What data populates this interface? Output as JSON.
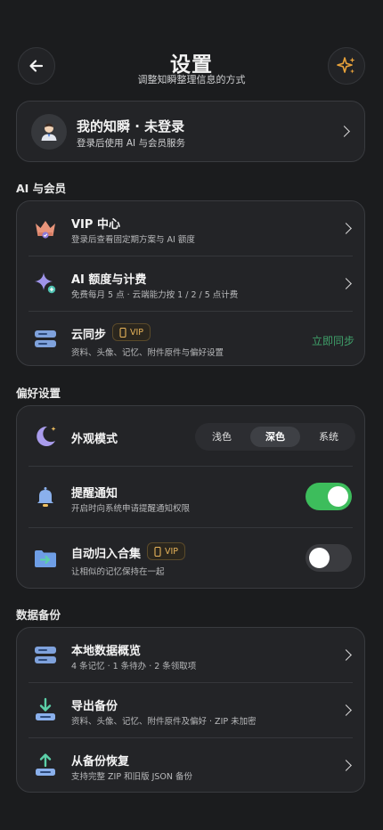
{
  "header": {
    "title": "设置",
    "subtitle": "调整知瞬整理信息的方式"
  },
  "account": {
    "title": "我的知瞬 · 未登录",
    "subtitle": "登录后使用 AI 与会员服务"
  },
  "sections": {
    "ai": "AI 与会员",
    "prefs": "偏好设置",
    "backup": "数据备份"
  },
  "ai_items": {
    "vip_title": "VIP 中心",
    "vip_sub": "登录后查看固定期方案与 AI 额度",
    "quota_title": "AI 额度与计费",
    "quota_sub": "免费每月 5 点 · 云端能力按 1 / 2 / 5 点计费",
    "sync_title": "云同步",
    "sync_badge": "VIP",
    "sync_sub": "资料、头像、记忆、附件原件与偏好设置",
    "sync_action": "立即同步"
  },
  "prefs_items": {
    "appearance_title": "外观模式",
    "appearance_options": [
      "浅色",
      "深色",
      "系统"
    ],
    "appearance_selected": "深色",
    "notify_title": "提醒通知",
    "notify_sub": "开启时向系统申请提醒通知权限",
    "notify_on": true,
    "archive_title": "自动归入合集",
    "archive_badge": "VIP",
    "archive_sub": "让相似的记忆保持在一起",
    "archive_on": false
  },
  "backup_items": {
    "local_title": "本地数据概览",
    "local_sub": "4 条记忆 · 1 条待办 · 2 条领取项",
    "export_title": "导出备份",
    "export_sub": "资料、头像、记忆、附件原件及偏好 · ZIP 未加密",
    "restore_title": "从备份恢复",
    "restore_sub": "支持完整 ZIP 和旧版 JSON 备份"
  },
  "colors": {
    "accent_green": "#3dbd5c",
    "vip_gold": "#e8b45a",
    "action_green": "#3fa06a"
  },
  "icons": {
    "back": "arrow-left-icon",
    "magic": "sparkles-icon"
  }
}
